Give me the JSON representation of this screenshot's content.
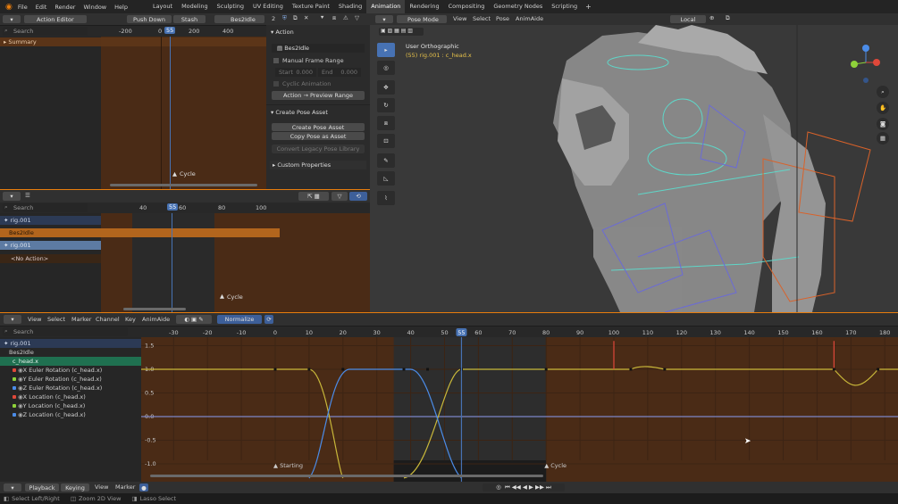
{
  "topbar": {
    "file": "File",
    "edit": "Edit",
    "render": "Render",
    "window": "Window",
    "help": "Help",
    "workspaces": [
      "Layout",
      "Modeling",
      "Sculpting",
      "UV Editing",
      "Texture Paint",
      "Shading",
      "Animation",
      "Rendering",
      "Compositing",
      "Geometry Nodes",
      "Scripting"
    ],
    "active_workspace": "Animation",
    "add_tab": "+"
  },
  "action_editor": {
    "mode": "Action Editor",
    "push_down": "Push Down",
    "stash": "Stash",
    "action_name": "Bes2Idle",
    "users": "2",
    "search_placeholder": "Search",
    "ticks": [
      "-200",
      "0",
      "200",
      "400"
    ],
    "frame": "55",
    "summary": "Summary",
    "marker": "Cycle"
  },
  "action_panel": {
    "header": "Action",
    "action_name": "Bes2Idle",
    "manual_range": "Manual Frame Range",
    "start_label": "Start",
    "start_value": "0.000",
    "end_label": "End",
    "end_value": "0.000",
    "cyclic": "Cyclic Animation",
    "preview_btn": "Action → Preview Range",
    "pose_header": "Create Pose Asset",
    "create_pose": "Create Pose Asset",
    "copy_pose": "Copy Pose as Asset",
    "convert": "Convert Legacy Pose Library",
    "custom": "Custom Properties"
  },
  "nla": {
    "search_placeholder": "Search",
    "ticks": [
      "40",
      "60",
      "80",
      "100"
    ],
    "frame": "55",
    "rig": "rig.001",
    "action": "Bes2Idle",
    "rig2": "rig.001",
    "no_action": "<No Action>",
    "marker": "Cycle"
  },
  "viewport": {
    "mode": "Pose Mode",
    "menus": [
      "View",
      "Select",
      "Pose",
      "AnimAide"
    ],
    "orientation": "Local",
    "view_name": "User Orthographic",
    "subtitle": "(55) rig.001 : c_head.x"
  },
  "graph": {
    "menus": [
      "View",
      "Select",
      "Marker",
      "Channel",
      "Key",
      "AnimAide"
    ],
    "normalize": "Normalize",
    "search_placeholder": "Search",
    "ticks": [
      "-30",
      "-20",
      "-10",
      "0",
      "10",
      "20",
      "30",
      "40",
      "50",
      "60",
      "70",
      "80",
      "90",
      "100",
      "110",
      "120",
      "130",
      "140",
      "150",
      "160",
      "170",
      "180"
    ],
    "frame": "55",
    "yticks": [
      "1.5",
      "1.0",
      "0.5",
      "0.0",
      "-0.5",
      "-1.0"
    ],
    "marker_start": "Starting",
    "marker_cycle": "Cycle",
    "channels": {
      "rig": "rig.001",
      "action": "Bes2Idle",
      "group": "c_head.x",
      "items": [
        {
          "label": "X Euler Rotation (c_head.x)",
          "color": "#e0483a"
        },
        {
          "label": "Y Euler Rotation (c_head.x)",
          "color": "#8ed23a"
        },
        {
          "label": "Z Euler Rotation (c_head.x)",
          "color": "#4b8ce8"
        },
        {
          "label": "X Location (c_head.x)",
          "color": "#e0483a"
        },
        {
          "label": "Y Location (c_head.x)",
          "color": "#8ed23a"
        },
        {
          "label": "Z Location (c_head.x)",
          "color": "#4b8ce8"
        }
      ]
    }
  },
  "timeline": {
    "playback": "Playback",
    "keying": "Keying",
    "view": "View",
    "marker": "Marker"
  },
  "status": {
    "select": "Select Left/Right",
    "zoom": "Zoom 2D View",
    "lasso": "Lasso Select"
  },
  "colors": {
    "accent": "#e87d0d",
    "playhead": "#4772b3",
    "bg": "#1d1d1d",
    "header": "#303030"
  }
}
